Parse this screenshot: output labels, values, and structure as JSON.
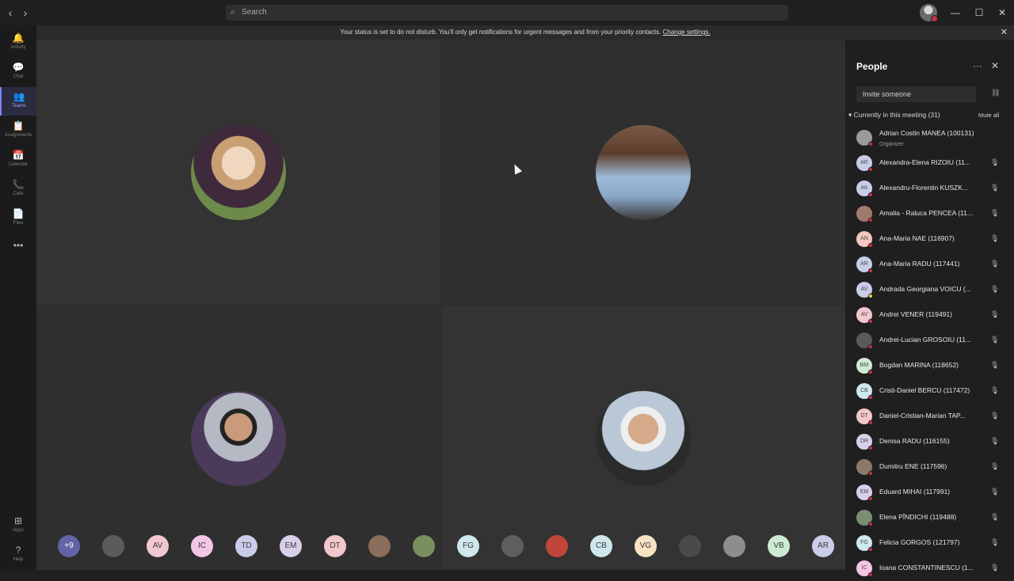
{
  "titlebar": {
    "back": "‹",
    "forward": "›",
    "search_placeholder": "Search",
    "minimize": "—",
    "maximize": "☐",
    "close": "✕"
  },
  "rail": [
    {
      "icon": "🔔",
      "label": "Activity"
    },
    {
      "icon": "💬",
      "label": "Chat"
    },
    {
      "icon": "👥",
      "label": "Teams"
    },
    {
      "icon": "📋",
      "label": "Assignments"
    },
    {
      "icon": "📅",
      "label": "Calendar"
    },
    {
      "icon": "📞",
      "label": "Calls"
    },
    {
      "icon": "📄",
      "label": "Files"
    },
    {
      "icon": "•••",
      "label": ""
    },
    {
      "icon": "⊞",
      "label": "Apps"
    },
    {
      "icon": "?",
      "label": "Help"
    }
  ],
  "banner": {
    "text": "Your status is set to do not disturb. You'll only get notifications for urgent messages and from your priority contacts.",
    "link": "Change settings.",
    "close": "✕"
  },
  "strip": [
    {
      "label": "+9",
      "color": "#6264a7"
    },
    {
      "label": "",
      "color": "#5b5b5b"
    },
    {
      "label": "AV",
      "color": "#f3c7cf"
    },
    {
      "label": "IC",
      "color": "#f2c6e4"
    },
    {
      "label": "TD",
      "color": "#c9cde9"
    },
    {
      "label": "EM",
      "color": "#d9cfe9"
    },
    {
      "label": "DT",
      "color": "#f2c6cb"
    },
    {
      "label": "",
      "color": "#8a6d5a"
    },
    {
      "label": "",
      "color": "#7a8f5e"
    },
    {
      "label": "FG",
      "color": "#cfe8ee"
    },
    {
      "label": "",
      "color": "#5e5e5e"
    },
    {
      "label": "",
      "color": "#c0463a"
    },
    {
      "label": "CB",
      "color": "#cfe8ee"
    },
    {
      "label": "VG",
      "color": "#f7e2c4"
    },
    {
      "label": "",
      "color": "#4a4a4a"
    },
    {
      "label": "",
      "color": "#8d8d8d"
    },
    {
      "label": "VB",
      "color": "#cdebd2"
    },
    {
      "label": "AR",
      "color": "#c9cde9"
    }
  ],
  "people": {
    "title": "People",
    "more": "···",
    "close": "✕",
    "invite_placeholder": "Invite someone",
    "section": "Currently in this meeting (31)",
    "mute_all": "Mute all",
    "list": [
      {
        "name": "Adrian Costin MANEA (100131)",
        "role": "Organizer",
        "initials": "",
        "color": "#9a9a9a",
        "status": "dnd"
      },
      {
        "name": "Alexandra-Elena RIZOIU (11...",
        "role": "",
        "initials": "AR",
        "color": "#c9cde9",
        "status": "dnd"
      },
      {
        "name": "Alexandru-Florentin KUSZK...",
        "role": "",
        "initials": "AK",
        "color": "#c9cde9",
        "status": "dnd"
      },
      {
        "name": "Amalia - Raluca PENCEA (11...",
        "role": "",
        "initials": "",
        "color": "#a07a6a",
        "status": "dnd"
      },
      {
        "name": "Ana-Maria NAE (116907)",
        "role": "",
        "initials": "AN",
        "color": "#f4c8c0",
        "status": "dnd"
      },
      {
        "name": "Ana-Maria RADU (117441)",
        "role": "",
        "initials": "AR",
        "color": "#c9cde9",
        "status": "dnd"
      },
      {
        "name": "Andrada Georgiana VOICU (...",
        "role": "",
        "initials": "AV",
        "color": "#c9cde9",
        "status": "away"
      },
      {
        "name": "Andrei VENER (119491)",
        "role": "",
        "initials": "AV",
        "color": "#f3c7cf",
        "status": "dnd"
      },
      {
        "name": "Andrei-Lucian GROSOIU (11...",
        "role": "",
        "initials": "",
        "color": "#5a5a5a",
        "status": "dnd"
      },
      {
        "name": "Bogdan MARINA (118652)",
        "role": "",
        "initials": "BM",
        "color": "#cdebd2",
        "status": "dnd"
      },
      {
        "name": "Cristi-Daniel BERCU (117472)",
        "role": "",
        "initials": "CB",
        "color": "#cfe8ee",
        "status": "dnd"
      },
      {
        "name": "Daniel-Cristian-Marian TAP...",
        "role": "",
        "initials": "DT",
        "color": "#f2c6cb",
        "status": "dnd"
      },
      {
        "name": "Denisa RADU (116155)",
        "role": "",
        "initials": "DR",
        "color": "#d9cfe9",
        "status": "dnd"
      },
      {
        "name": "Dumitru ENE (117596)",
        "role": "",
        "initials": "",
        "color": "#8a7a6a",
        "status": "dnd"
      },
      {
        "name": "Eduard MIHAI (117991)",
        "role": "",
        "initials": "EM",
        "color": "#d9cfe9",
        "status": "dnd"
      },
      {
        "name": "Elena PÎNDICHI (119488)",
        "role": "",
        "initials": "",
        "color": "#7a8f6e",
        "status": "dnd"
      },
      {
        "name": "Felicia GORGOS (121797)",
        "role": "",
        "initials": "FG",
        "color": "#cfe8ee",
        "status": "dnd"
      },
      {
        "name": "Ioana CONSTANTINESCU (1...",
        "role": "",
        "initials": "IC",
        "color": "#f2c6e4",
        "status": "dnd"
      }
    ]
  }
}
